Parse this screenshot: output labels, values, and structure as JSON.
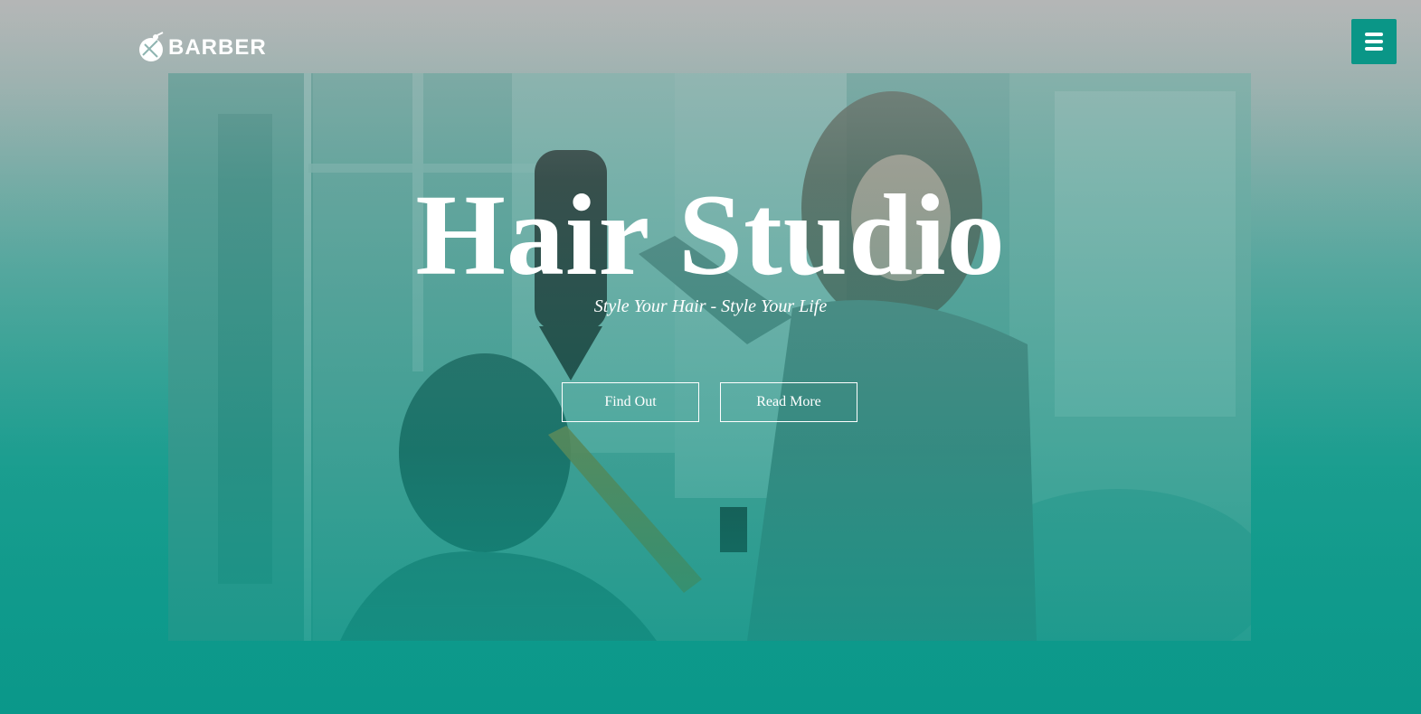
{
  "header": {
    "logo_text": "BARBER",
    "logo_icon": "barber-scissors-icon",
    "menu_icon": "hamburger-menu-icon"
  },
  "hero": {
    "title": "Hair Studio",
    "subtitle": "Style Your Hair - Style Your Life",
    "buttons": [
      {
        "label": "Find Out"
      },
      {
        "label": "Read More"
      }
    ]
  },
  "colors": {
    "accent": "#0a9687",
    "text": "#ffffff"
  }
}
